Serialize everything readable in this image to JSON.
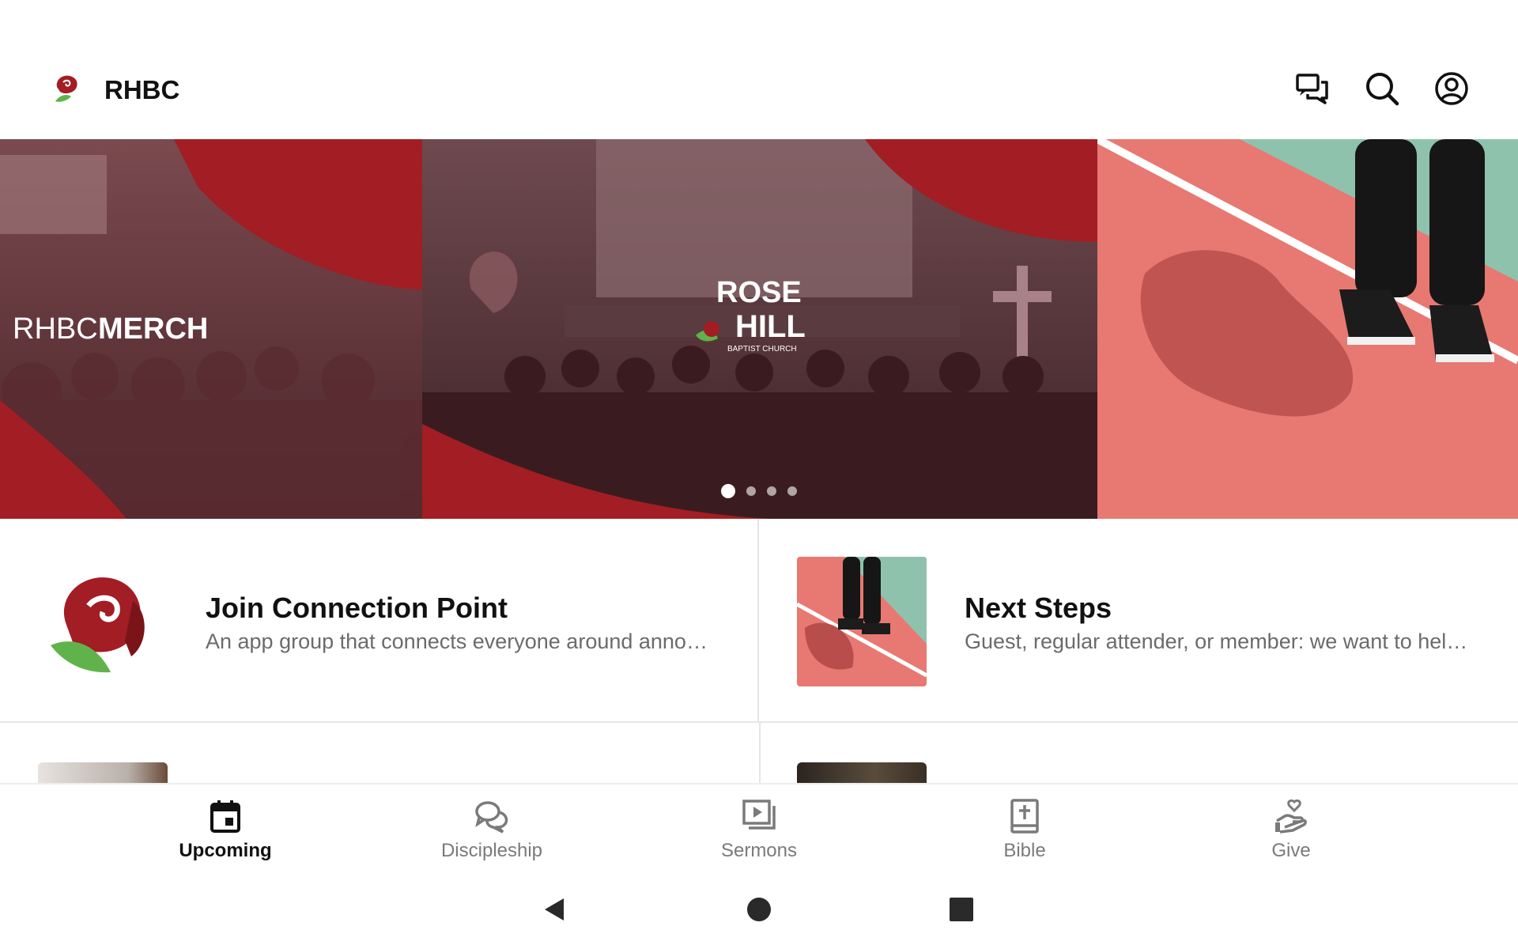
{
  "header": {
    "title": "RHBC",
    "icons": [
      "chat-icon",
      "search-icon",
      "account-icon"
    ]
  },
  "carousel": {
    "slides": [
      {
        "kind": "merch",
        "text_light": "RHBC",
        "text_bold": "MERCH"
      },
      {
        "kind": "logo",
        "line1": "ROSE",
        "line2": "HILL",
        "line3": "BAPTIST CHURCH"
      },
      {
        "kind": "photo"
      }
    ],
    "dot_count": 4,
    "active_index": 0
  },
  "cards": [
    {
      "title": "Join Connection Point",
      "description": "An app group that connects everyone around anno…"
    },
    {
      "title": "Next Steps",
      "description": "Guest, regular attender, or member: we want to hel…"
    }
  ],
  "tabs": [
    {
      "label": "Upcoming",
      "icon": "calendar-icon",
      "active": true
    },
    {
      "label": "Discipleship",
      "icon": "chat-bubbles-icon",
      "active": false
    },
    {
      "label": "Sermons",
      "icon": "video-icon",
      "active": false
    },
    {
      "label": "Bible",
      "icon": "bible-icon",
      "active": false
    },
    {
      "label": "Give",
      "icon": "give-icon",
      "active": false
    }
  ],
  "colors": {
    "brand_red": "#a31d24",
    "leaf_green": "#5fb34a",
    "tab_active": "#111111",
    "tab_inactive": "#7a7a7a"
  }
}
